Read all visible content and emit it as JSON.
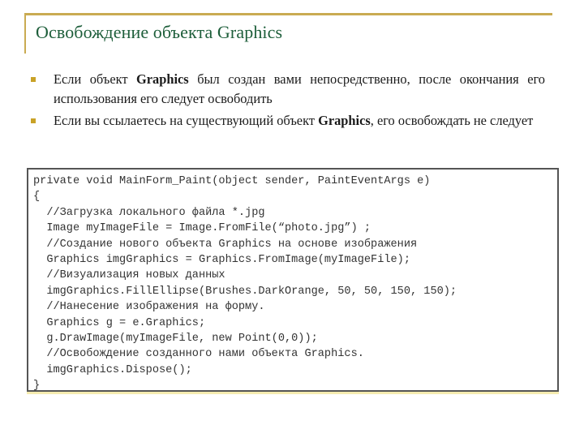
{
  "slide": {
    "title": "Освобождение объекта Graphics",
    "accent_color": "#c9ab52",
    "title_color": "#1d5e3a",
    "bullets": [
      {
        "before": "Если объект ",
        "bold": "Graphics",
        "after": " был создан вами непосредственно, после окончания его использования его следует освободить"
      },
      {
        "before": "Если вы ссылаетесь на существующий объект ",
        "bold": "Graphics",
        "after": ", его освобождать не следует"
      }
    ],
    "code_lines": [
      "private void MainForm_Paint(object sender, PaintEventArgs e)",
      "{",
      "  //Загрузка локального файла *.jpg",
      "  Image myImageFile = Image.FromFile(“photo.jpg”) ;",
      "  //Создание нового объекта Graphics на основе изображения",
      "  Graphics imgGraphics = Graphics.FromImage(myImageFile);",
      "  //Визуализация новых данных",
      "  imgGraphics.FillEllipse(Brushes.DarkOrange, 50, 50, 150, 150);",
      "  //Нанесение изображения на форму.",
      "  Graphics g = e.Graphics;",
      "  g.DrawImage(myImageFile, new Point(0,0));",
      "  //Освобождение созданного нами объекта Graphics.",
      "  imgGraphics.Dispose();",
      "}"
    ]
  }
}
